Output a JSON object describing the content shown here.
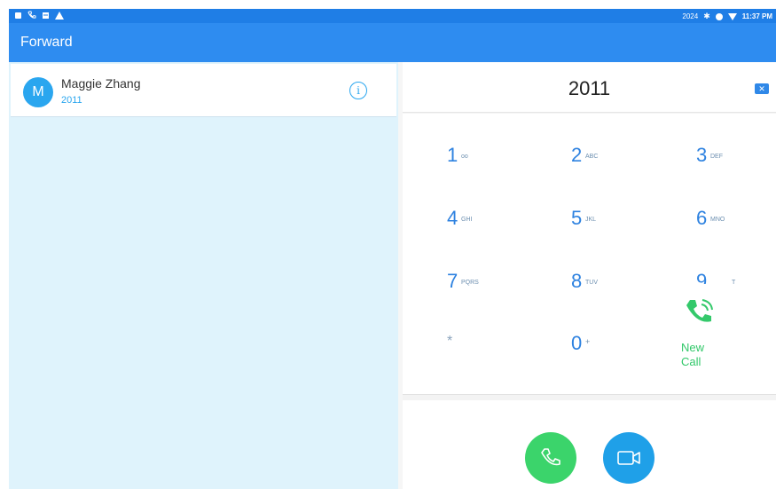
{
  "status_bar": {
    "left_icons": [
      "sim-icon",
      "phone-icon",
      "message-icon",
      "warning-icon"
    ],
    "right_text": "2024",
    "right_icons": [
      "bluetooth-icon",
      "location-icon",
      "wifi-icon"
    ],
    "time": "11:37 PM"
  },
  "app_bar": {
    "title": "Forward"
  },
  "contacts": [
    {
      "avatar_letter": "M",
      "name": "Maggie Zhang",
      "number": "2011",
      "info_icon": "info-icon"
    }
  ],
  "dialer": {
    "number": "2011",
    "backspace_glyph": "✕",
    "keys": [
      {
        "digit": "1",
        "letters": "oo"
      },
      {
        "digit": "2",
        "letters": "ABC"
      },
      {
        "digit": "3",
        "letters": "DEF"
      },
      {
        "digit": "4",
        "letters": "GHI"
      },
      {
        "digit": "5",
        "letters": "JKL"
      },
      {
        "digit": "6",
        "letters": "MNO"
      },
      {
        "digit": "7",
        "letters": "PQRS"
      },
      {
        "digit": "8",
        "letters": "TUV"
      },
      {
        "digit": "9",
        "letters": "T"
      },
      {
        "digit": "*",
        "letters": ""
      },
      {
        "digit": "0",
        "letters": "+"
      }
    ],
    "new_call_popup": {
      "line1": "New",
      "line2": "Call"
    },
    "buttons": {
      "voice": "phone-icon",
      "video": "video-camera-icon"
    }
  },
  "colors": {
    "app_bar": "#2e8cf0",
    "status_bar": "#1f7ee6",
    "accent": "#2aa6ef",
    "call_green": "#3bd46b",
    "video_blue": "#1fa0e8",
    "left_panel_bg": "#dff3fc"
  }
}
